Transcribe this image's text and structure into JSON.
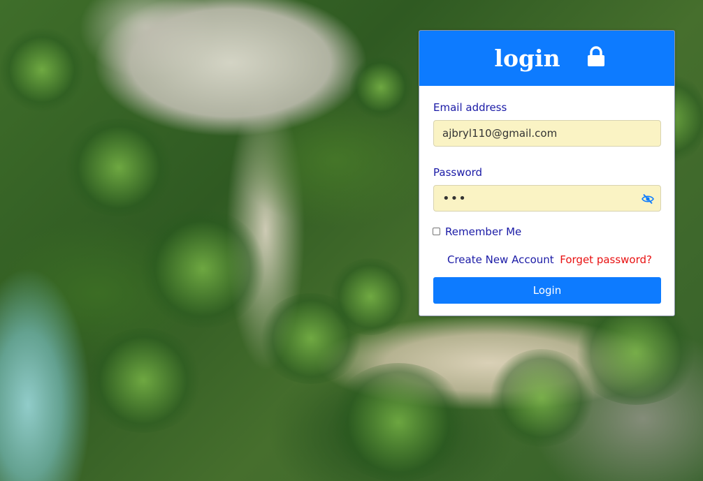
{
  "login_card": {
    "title": "login",
    "lock_icon": "lock-icon",
    "email": {
      "label": "Email address",
      "value": "ajbryl110@gmail.com"
    },
    "password": {
      "label": "Password",
      "masked_value": "•••",
      "toggle_icon": "eye-slash-icon"
    },
    "remember_me": {
      "label": "Remember Me",
      "checked": false
    },
    "create_account_link": "Create New Account",
    "forgot_password_link": "Forget password?",
    "login_button": "Login"
  },
  "colors": {
    "accent": "#0d7bff",
    "label_text": "#1a1aa6",
    "forgot_link": "#e81010",
    "autofill_input": "#faf3c4"
  }
}
